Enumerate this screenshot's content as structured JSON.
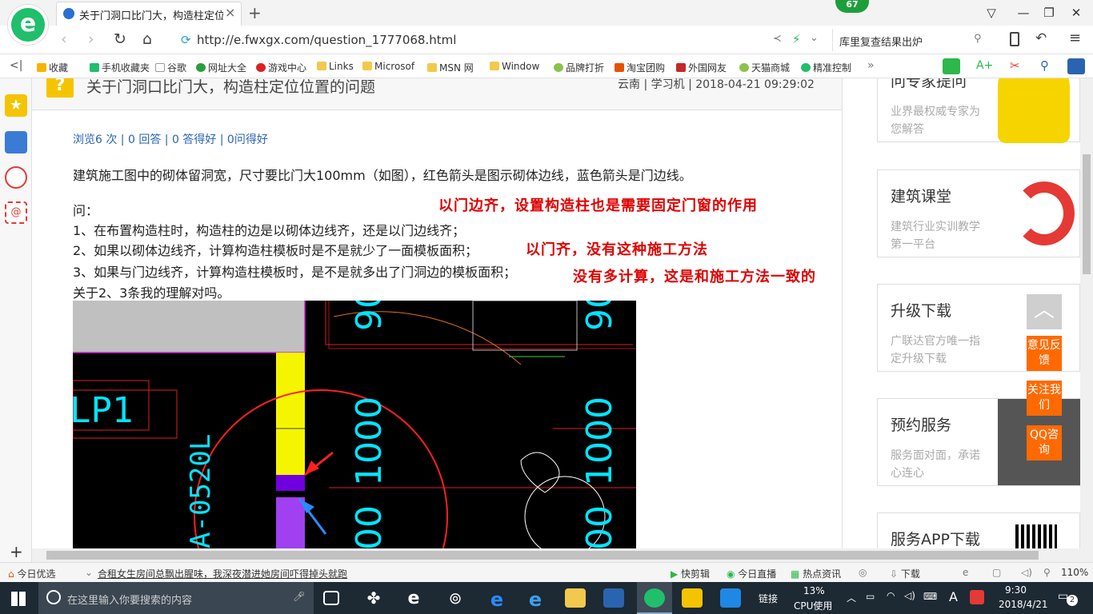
{
  "browser": {
    "tab_title": "关于门洞口比门大，构造柱定位位置的问题",
    "badge_count": "67",
    "url": "http://e.fwxgx.com/question_1777068.html",
    "search_text": "库里复查结果出炉"
  },
  "bookmarks": [
    "收藏",
    "手机收藏夹",
    "谷歌",
    "网址大全",
    "游戏中心",
    "Links",
    "Microsof",
    "MSN 网",
    "Window",
    "品牌打折",
    "淘宝团购",
    "外国网友",
    "天猫商城",
    "精准控制"
  ],
  "question": {
    "title": "关于门洞口比门大，构造柱定位位置的问题",
    "meta": "云南 | 学习机 | 2018-04-21 09:29:02",
    "stats": "浏览6 次 | 0 回答 | 0 答得好 | 0问得好",
    "body_line1": "建筑施工图中的砌体留洞宽，尺寸要比门大100mm（如图），红色箭头是图示砌体边线，蓝色箭头是门边线。",
    "ask_label": "问：",
    "q1": "1、在布置构造柱时，构造柱的边是以砌体边线齐，还是以门边线齐；",
    "q2": "2、如果以砌体边线齐，计算构造柱模板时是不是就少了一面模板面积；",
    "q3": "3、如果与门边线齐，计算构造柱模板时，是不是就多出了门洞边的模板面积；",
    "q4": "关于2、3条我的理解对吗。",
    "annotation1": "以门边齐，设置构造柱也是需要固定门窗的作用",
    "annotation2": "以门齐，没有这种施工方法",
    "annotation3": "没有多计算，这是和施工方法一致的"
  },
  "cad": {
    "label_lp1": "LP1",
    "label_door": "A-0520L",
    "dim_1000a": "1000",
    "dim_1000b": "1000",
    "dim_90a": "90",
    "dim_90b": "90",
    "dim_00a": "00",
    "dim_00b": "00"
  },
  "sidebar_cards": [
    {
      "title": "问专家提问",
      "sub": "业界最权威专家为您解答"
    },
    {
      "title": "建筑课堂",
      "sub": "建筑行业实训教学第一平台"
    },
    {
      "title": "升级下载",
      "sub": "广联达官方唯一指定升级下载"
    },
    {
      "title": "预约服务",
      "sub": "服务面对面，承诺心连心"
    },
    {
      "title": "服务APP下载",
      "sub": ""
    }
  ],
  "float_buttons": [
    "意见反馈",
    "关注我们",
    "QQ咨询"
  ],
  "statusbar": {
    "today_pick": "今日优选",
    "news": "合租女生房间总飘出腥味，我深夜潜进她房间吓得掉头就跑",
    "kuaijianji": "快剪辑",
    "live": "今日直播",
    "hot": "热点资讯",
    "download": "下载",
    "zoom": "110%"
  },
  "taskbar": {
    "search_placeholder": "在这里输入你要搜索的内容",
    "link_label": "链接",
    "cpu_value": "13%",
    "cpu_label": "CPU使用",
    "time": "9:30",
    "date": "2018/4/21",
    "notif_count": "2",
    "ime": "A"
  },
  "colors": {
    "accent_green": "#1fbf6b",
    "annotation_red": "#e00000",
    "link_blue": "#2a64b0",
    "float_orange": "#ff6a00"
  }
}
